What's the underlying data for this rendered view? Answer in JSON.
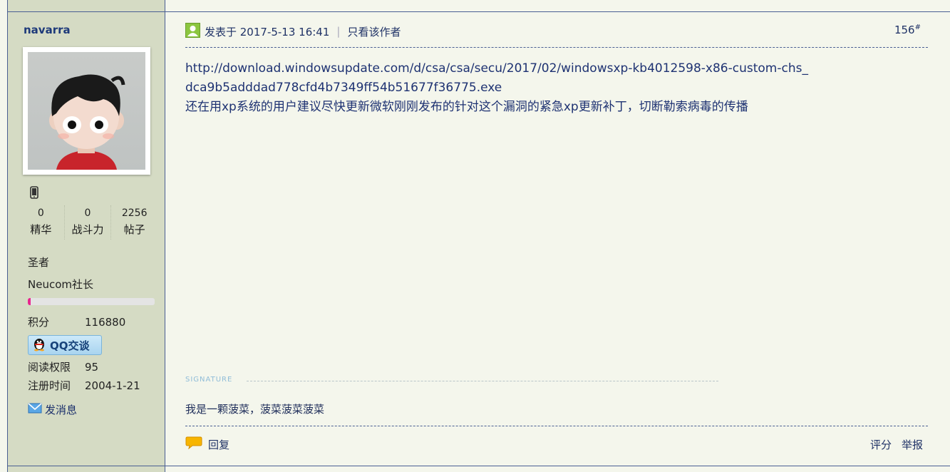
{
  "user": {
    "name": "navarra",
    "stats": [
      {
        "value": "0",
        "label": "精华"
      },
      {
        "value": "0",
        "label": "战斗力"
      },
      {
        "value": "2256",
        "label": "帖子"
      }
    ],
    "rank_title": "圣者",
    "group": "Neucom社长",
    "progress_fraction": 0.02,
    "points_label": "积分",
    "points_value": "116880",
    "qq_label": "QQ交谈",
    "read_perm_label": "阅读权限",
    "read_perm_value": "95",
    "reg_label": "注册时间",
    "reg_value": "2004-1-21",
    "message_label": "发消息"
  },
  "post": {
    "posted_label": "发表于 2017-5-13 16:41",
    "only_author_label": "只看该作者",
    "floor": "156",
    "floor_mark": "#",
    "url": "http://download.windowsupdate.com/d/csa/csa/secu/2017/02/windowsxp-kb4012598-x86-custom-chs_dca9b5adddad778cfd4b7349ff54b51677f36775.exe",
    "text": "还在用xp系统的用户建议尽快更新微软刚刚发布的针对这个漏洞的紧急xp更新补丁，切断勒索病毒的传播",
    "signature_label": "SIGNATURE",
    "signature_text": "我是一颗菠菜，菠菜菠菜菠菜",
    "reply_label": "回复",
    "rate_label": "评分",
    "report_label": "举报"
  },
  "colors": {
    "sidebar_bg": "#d5dbc4",
    "content_bg": "#f4f6ec",
    "border": "#4a5f93",
    "link": "#1e3272"
  }
}
